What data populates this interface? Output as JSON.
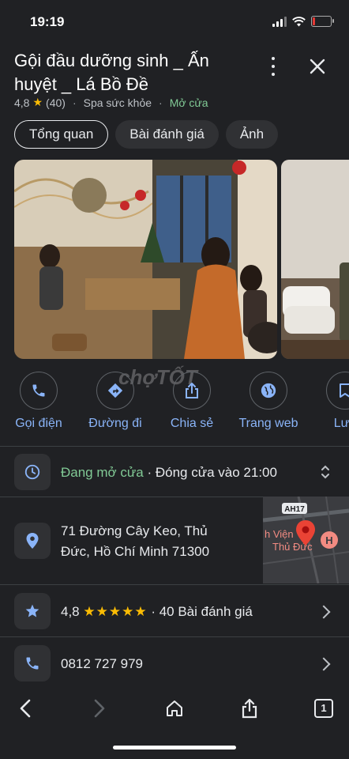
{
  "status": {
    "time": "19:19"
  },
  "place": {
    "title": "Gội đầu dưỡng sinh _ Ấn huyệt _ Lá Bồ Đề",
    "rating": "4,8",
    "reviews_count": "(40)",
    "category": "Spa sức khỏe",
    "open_status": "Mở cửa"
  },
  "tabs": [
    {
      "label": "Tổng quan",
      "active": true
    },
    {
      "label": "Bài đánh giá",
      "active": false
    },
    {
      "label": "Ảnh",
      "active": false
    }
  ],
  "watermark": "chợTỐT",
  "actions": [
    {
      "label": "Gọi điện",
      "icon": "phone-icon"
    },
    {
      "label": "Đường đi",
      "icon": "directions-icon"
    },
    {
      "label": "Chia sẻ",
      "icon": "share-icon"
    },
    {
      "label": "Trang web",
      "icon": "globe-icon"
    },
    {
      "label": "Lưu",
      "icon": "bookmark-icon"
    }
  ],
  "hours": {
    "open_label": "Đang mở cửa",
    "close_label": "· Đóng cửa vào 21:00"
  },
  "address": {
    "line1": "71 Đường Cây Keo, Thủ",
    "line2": "Đức, Hồ Chí Minh 71300"
  },
  "map": {
    "road_label": "AH17",
    "label1": "h Viện",
    "label2": "Thủ Đức",
    "marker_letter": "H"
  },
  "rating_row": {
    "value": "4,8",
    "stars": "★★★★★",
    "text": "· 40 Bài đánh giá"
  },
  "phone": {
    "number": "0812 727 979"
  },
  "toolbar": {
    "tab_count": "1"
  },
  "colors": {
    "background": "#202124",
    "accent": "#8ab4f8",
    "open_green": "#81c995",
    "star": "#fbbc04"
  }
}
